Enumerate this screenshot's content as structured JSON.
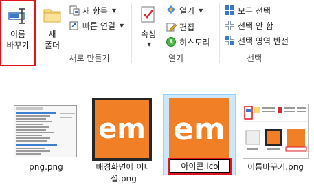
{
  "ribbon": {
    "organize": {
      "rename_button": {
        "line1": "이름",
        "line2": "바꾸기"
      }
    },
    "new": {
      "new_folder": {
        "line1": "새",
        "line2": "폴더"
      },
      "new_item": "새 항목",
      "easy_access": "빠른 연결",
      "group_label": "새로 만들기"
    },
    "open": {
      "properties": "속성",
      "open_item": "열기",
      "edit_item": "편집",
      "history_item": "히스토리",
      "group_label": "열기"
    },
    "select": {
      "select_all": "모두 선택",
      "select_none": "선택 안 함",
      "invert_selection": "선택 영역 반전",
      "group_label": "선택"
    }
  },
  "files": [
    {
      "name": "png.png",
      "thumbnail": "screenshot-list"
    },
    {
      "name": "배경화면에 이니셜.png",
      "line1": "배경화면에 이니",
      "line2": "셜.png",
      "thumbnail_text": "em"
    },
    {
      "name": "아이콘.ico",
      "thumbnail_text": "em",
      "rename_value": "아이콘.ico",
      "selected": true
    },
    {
      "name": "이름바꾸기.png",
      "thumbnail": "screenshot-explorer"
    }
  ],
  "colors": {
    "accent_red": "#e0141e",
    "tile_orange": "#f07f25",
    "selection_blue": "#cce8ff"
  }
}
